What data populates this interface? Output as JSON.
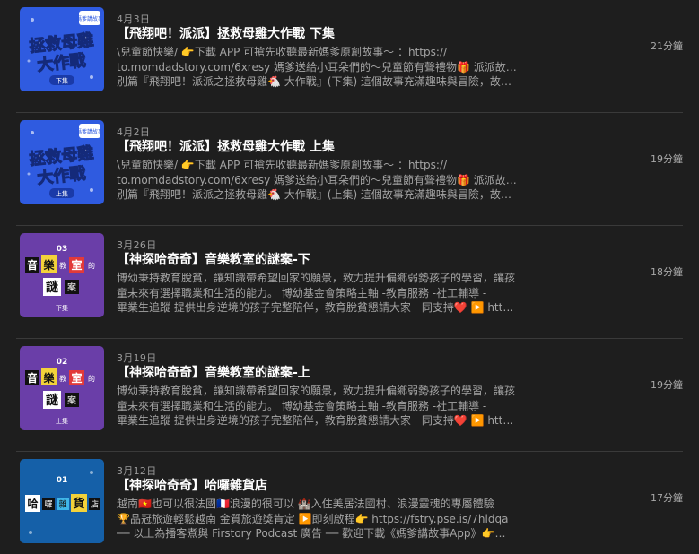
{
  "episodes": [
    {
      "date": "4月3日",
      "title": "【飛翔吧！派派】拯救母雞大作戰 下集",
      "desc": [
        "\\兒童節快樂/ 👉下載 APP 可搶先收聽最新媽爹原創故事～ ：https://",
        "to.momdadstory.com/6xresy 媽爹送給小耳朵們的～兒童節有聲禮物🎁 派派故事特",
        "別篇『飛翔吧！派派之拯救母雞🐔 大作戰』(下集) 這個故事充滿趣味與冒險，故事…"
      ],
      "duration": "21分鐘",
      "thumb": {
        "headline1": "拯救母雞",
        "headline2": "大作戰",
        "badge": "下集",
        "corner": "媽爹講故事",
        "style": "blue"
      }
    },
    {
      "date": "4月2日",
      "title": "【飛翔吧！派派】拯救母雞大作戰 上集",
      "desc": [
        "\\兒童節快樂/ 👉下載 APP 可搶先收聽最新媽爹原創故事～ ：https://",
        "to.momdadstory.com/6xresy 媽爹送給小耳朵們的～兒童節有聲禮物🎁 派派故事特",
        "別篇『飛翔吧！派派之拯救母雞🐔 大作戰』(上集) 這個故事充滿趣味與冒險，故事…"
      ],
      "duration": "19分鐘",
      "thumb": {
        "headline1": "拯救母雞",
        "headline2": "大作戰",
        "badge": "上集",
        "corner": "媽爹講故事",
        "style": "blue"
      }
    },
    {
      "date": "3月26日",
      "title": "【神探哈奇奇】音樂教室的謎案-下",
      "desc": [
        "博幼秉持教育脫貧，讓知識帶希望回家的願景，致力提升偏鄉弱勢孩子的學習，讓孩",
        "童未來有選擇職業和生活的能力。 博幼基金會策略主軸 -教育服務 -社工輔導 -",
        "畢業生追蹤 提供出身逆境的孩子完整陪伴，教育脫貧懇請大家一同支持❤️ ▶️ htt…"
      ],
      "duration": "18分鐘",
      "thumb": {
        "number": "03",
        "line1": [
          "音",
          "樂",
          "教",
          "室",
          "的"
        ],
        "line2": [
          "謎",
          "案"
        ],
        "badge": "下集",
        "style": "purple"
      }
    },
    {
      "date": "3月19日",
      "title": "【神探哈奇奇】音樂教室的謎案-上",
      "desc": [
        "博幼秉持教育脫貧，讓知識帶希望回家的願景，致力提升偏鄉弱勢孩子的學習，讓孩",
        "童未來有選擇職業和生活的能力。 博幼基金會策略主軸 -教育服務 -社工輔導 -",
        "畢業生追蹤 提供出身逆境的孩子完整陪伴，教育脫貧懇請大家一同支持❤️ ▶️ htt…"
      ],
      "duration": "19分鐘",
      "thumb": {
        "number": "02",
        "line1": [
          "音",
          "樂",
          "教",
          "室",
          "的"
        ],
        "line2": [
          "謎",
          "案"
        ],
        "badge": "上集",
        "style": "purple"
      }
    },
    {
      "date": "3月12日",
      "title": "【神探哈奇奇】哈囉雜貨店",
      "desc": [
        "越南🇻🇳也可以很法國🇫🇷浪漫的很可以 🏰入住美居法國村、浪漫靈魂的專屬體驗",
        "🏆品冠旅遊輕鬆越南 金質旅遊獎肯定 ▶️即刻啟程👉 https://fstry.pse.is/7hldqa",
        "── 以上為播客煮與 Firstory Podcast 廣告 ── 歡迎下載《媽爹講故事App》👉…"
      ],
      "duration": "17分鐘",
      "thumb": {
        "number": "01",
        "line1": [
          "哈",
          "囉",
          "雜",
          "貨",
          "店"
        ],
        "line2": [],
        "badge": "",
        "style": "teal"
      }
    }
  ],
  "colors": {
    "background": "#1e1e1e",
    "divider": "#3a3a3a",
    "title": "#ffffff",
    "meta": "#9a9a9a",
    "thumb_blue": "#2f5be0",
    "thumb_purple": "#6a3ea8",
    "thumb_teal": "#1560a8"
  }
}
